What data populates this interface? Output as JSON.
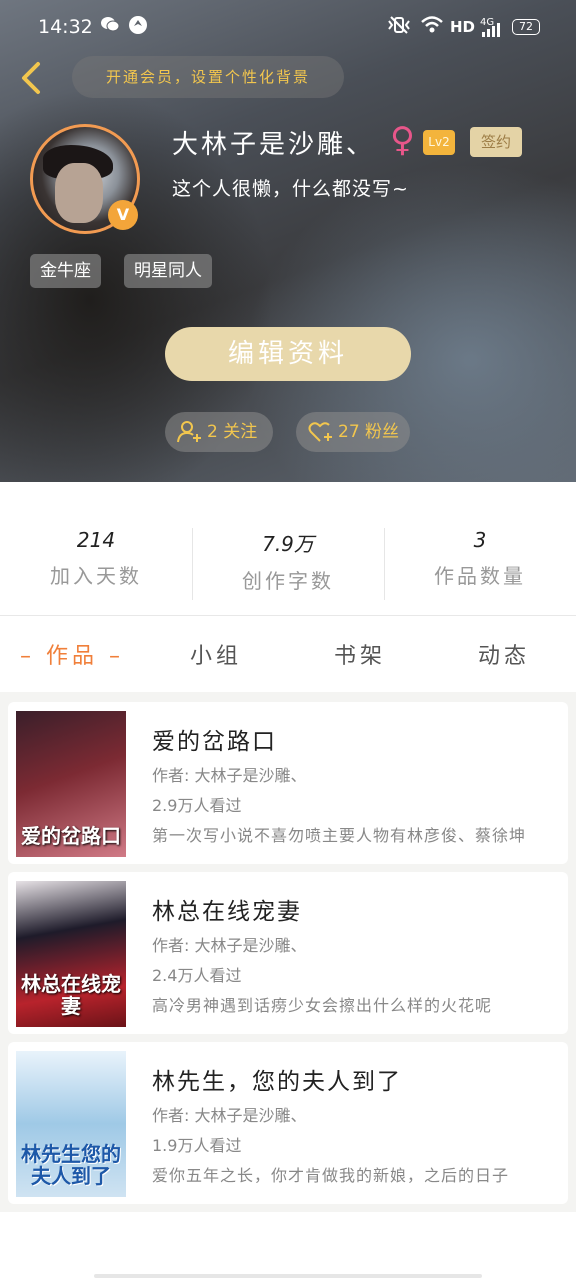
{
  "status_bar": {
    "time": "14:32",
    "hd": "HD",
    "network": "4G",
    "battery": "72"
  },
  "header": {
    "vip_banner": "开通会员，设置个性化背景",
    "username": "大林子是沙雕、",
    "gender_symbol": "♀",
    "level": "Lv2",
    "sign_badge": "签约",
    "bio": "这个人很懒，什么都没写~",
    "verified_badge": "V",
    "tags": [
      "金牛座",
      "明星同人"
    ],
    "edit_button": "编辑资料",
    "follow_label": "2 关注",
    "fans_label": "27 粉丝"
  },
  "stats": [
    {
      "value": "214",
      "label": "加入天数"
    },
    {
      "value": "7.9万",
      "label": "创作字数"
    },
    {
      "value": "3",
      "label": "作品数量"
    }
  ],
  "tabs": [
    {
      "label": "– 作品 –",
      "active": true
    },
    {
      "label": "小组",
      "active": false
    },
    {
      "label": "书架",
      "active": false
    },
    {
      "label": "动态",
      "active": false
    }
  ],
  "books": [
    {
      "title": "爱的岔路口",
      "author": "作者: 大林子是沙雕、",
      "views": "2.9万人看过",
      "desc": "第一次写小说不喜勿喷主要人物有林彦俊、蔡徐坤",
      "cover_text": "爱的岔路口",
      "cover_colors": [
        "#7c2a33",
        "#c95f6f"
      ]
    },
    {
      "title": "林总在线宠妻",
      "author": "作者: 大林子是沙雕、",
      "views": "2.4万人看过",
      "desc": "高冷男神遇到话痨少女会擦出什么样的火花呢",
      "cover_text": "林总在线宠妻",
      "cover_colors": [
        "#1e1b2a",
        "#b8232c"
      ]
    },
    {
      "title": "林先生，您的夫人到了",
      "author": "作者: 大林子是沙雕、",
      "views": "1.9万人看过",
      "desc": "爱你五年之长，你才肯做我的新娘，之后的日子",
      "cover_text": "林先生您的夫人到了",
      "cover_colors": [
        "#9fc9e6",
        "#e9f3fb"
      ]
    }
  ],
  "colors": {
    "accent": "#f07f3a",
    "gold": "#f2c64e",
    "edit_button_bg": "#e8d8ab"
  }
}
